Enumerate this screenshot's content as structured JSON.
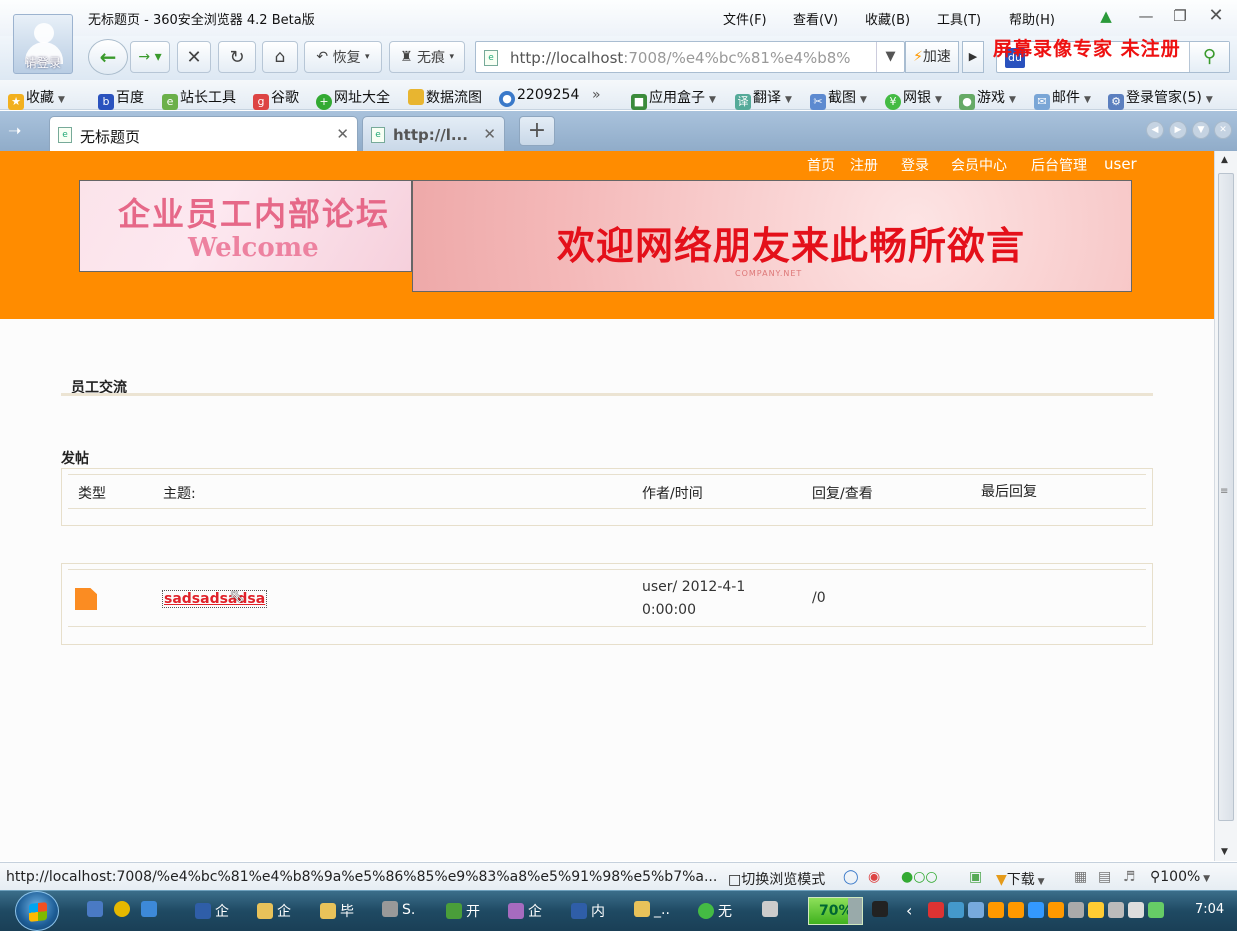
{
  "browser": {
    "avatar_label": "请登录",
    "window_title": "无标题页 - 360安全浏览器 4.2 Beta版",
    "menu": [
      "文件(F)",
      "查看(V)",
      "收藏(B)",
      "工具(T)",
      "帮助(H)"
    ],
    "toolbar": {
      "restore_label": "恢复",
      "incognito_label": "无痕",
      "address_host": "http://localhost",
      "address_rest": ":7008/%e4%bc%81%e4%b8%",
      "speed_label": "加速",
      "search_placeholder": ""
    },
    "watermark": "屏幕录像专家  未注册",
    "bookmarks": [
      "收藏",
      "百度",
      "站长工具",
      "谷歌",
      "网址大全",
      "数据流图",
      "2209254",
      "»",
      "应用盒子",
      "翻译",
      "截图",
      "网银",
      "游戏",
      "邮件",
      "登录管家(5)"
    ],
    "tabs": [
      {
        "title": "无标题页",
        "active": true
      },
      {
        "title": "http://l...",
        "active": false
      }
    ],
    "new_tab": "+"
  },
  "site": {
    "nav": [
      "首页",
      "注册",
      "登录",
      "会员中心",
      "后台管理",
      "user"
    ],
    "logo_line1": "企业员工内部论坛",
    "logo_line2": "Welcome",
    "banner_text": "欢迎网络朋友来此畅所欲言",
    "banner_small": "COMPANY.NET",
    "section_title": "员工交流",
    "post_label": "发帖",
    "table_headers": {
      "type": "类型",
      "subject": "主题:",
      "author": "作者/时间",
      "reply": "回复/查看",
      "last": "最后回复"
    },
    "posts": [
      {
        "subject": "sadsadsadsa",
        "author_line1": "user/ 2012-4-1",
        "author_line2": "0:00:00",
        "reply": "/0",
        "last": ""
      }
    ]
  },
  "status": {
    "url": "http://localhost:7008/%e4%bc%81%e4%b8%9a%e5%86%85%e9%83%a8%e5%91%98%e5%b7%a...",
    "switch_mode": "切换浏览模式",
    "download": "下载",
    "zoom": "100%"
  },
  "taskbar": {
    "items": [
      "企",
      "企",
      "毕",
      "S.",
      "开",
      "企",
      "内",
      "_..",
      "无"
    ],
    "battery": "70%",
    "clock": "7:04"
  }
}
